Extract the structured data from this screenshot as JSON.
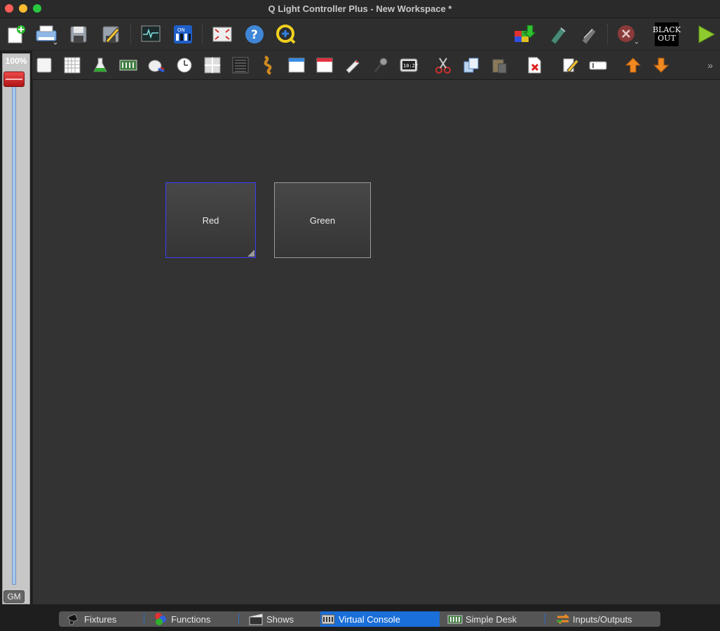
{
  "window": {
    "title": "Q Light Controller Plus - New Workspace *"
  },
  "grand_master": {
    "percent_label": "100%",
    "level_percent": 100,
    "label": "GM"
  },
  "toolbar2": {
    "overflow": "»"
  },
  "toolbar1_right": {
    "blackout_line1": "BLACK",
    "blackout_line2": "OUT"
  },
  "vc_buttons": [
    {
      "label": "Red"
    },
    {
      "label": "Green"
    }
  ],
  "tabs": [
    {
      "label": "Fixtures"
    },
    {
      "label": "Functions"
    },
    {
      "label": "Shows"
    },
    {
      "label": "Virtual Console",
      "active": true
    },
    {
      "label": "Simple Desk"
    },
    {
      "label": "Inputs/Outputs"
    }
  ],
  "colors": {
    "accent": "#1a6fd8",
    "selection_border": "#3b3bff",
    "canvas": "#333333"
  }
}
